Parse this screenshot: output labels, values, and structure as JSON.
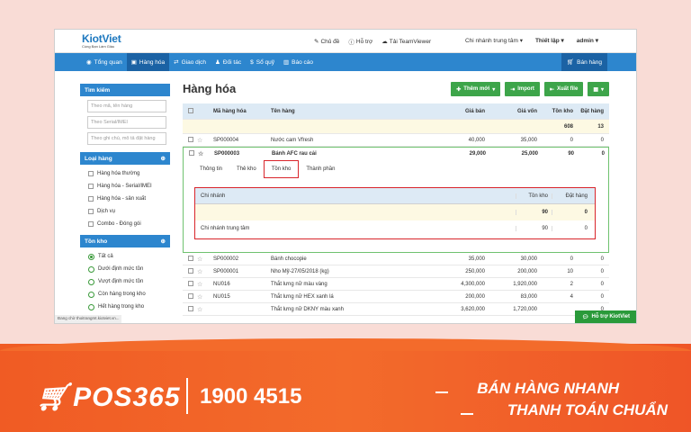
{
  "app": {
    "logo": "KiotViet",
    "logo_sub": "Cùng Bạn Làm Giàu"
  },
  "toplinks": [
    "Chủ đề",
    "Hỗ trợ",
    "Tải TeamViewer"
  ],
  "branch": "Chi nhánh trung tâm",
  "settings": "Thiết lập",
  "user": "admin",
  "nav": [
    "Tổng quan",
    "Hàng hóa",
    "Giao dịch",
    "Đối tác",
    "Sổ quỹ",
    "Báo cáo"
  ],
  "nav_sale": "Bán hàng",
  "sidebar": {
    "search_title": "Tìm kiếm",
    "search_placeholders": [
      "Theo mã, tên hàng",
      "Theo Serial/IMEI",
      "Theo ghi chú, mô tả đặt hàng"
    ],
    "type_title": "Loại hàng",
    "types": [
      "Hàng hóa thường",
      "Hàng hóa - Serial/IMEI",
      "Hàng hóa - sản xuất",
      "Dịch vụ",
      "Combo - Đóng gói"
    ],
    "stock_title": "Tồn kho",
    "stock_opts": [
      "Tất cả",
      "Dưới định mức tồn",
      "Vượt định mức tồn",
      "Còn hàng trong kho",
      "Hết hàng trong kho"
    ]
  },
  "page_title": "Hàng hóa",
  "buttons": {
    "add": "Thêm mới",
    "import": "Import",
    "export": "Xuất file"
  },
  "table": {
    "headers": [
      "Mã hàng hóa",
      "Tên hàng",
      "Giá bán",
      "Giá vốn",
      "Tồn kho",
      "Đặt hàng"
    ],
    "totals": {
      "stock": "608",
      "order": "13"
    },
    "rows_top": [
      {
        "code": "SP000004",
        "name": "Nước cam Vfresh",
        "price": "40,000",
        "cost": "35,000",
        "stock": "0",
        "order": "0"
      },
      {
        "code": "SP000003",
        "name": "Bánh AFC rau cải",
        "price": "29,000",
        "cost": "25,000",
        "stock": "90",
        "order": "0"
      }
    ],
    "rows_bottom": [
      {
        "code": "SP000002",
        "name": "Bánh chocopie",
        "price": "35,000",
        "cost": "30,000",
        "stock": "0",
        "order": "0"
      },
      {
        "code": "SP000001",
        "name": "Nho Mỹ-27/05/2018 (kg)",
        "price": "250,000",
        "cost": "200,000",
        "stock": "10",
        "order": "0"
      },
      {
        "code": "NU016",
        "name": "Thắt lưng nữ màu vàng",
        "price": "4,300,000",
        "cost": "1,920,000",
        "stock": "2",
        "order": "0"
      },
      {
        "code": "NU015",
        "name": "Thắt lưng nữ HEX xanh lá",
        "price": "200,000",
        "cost": "83,000",
        "stock": "4",
        "order": "0"
      },
      {
        "code": "",
        "name": "Thắt lưng nữ DKNY màu xanh",
        "price": "3,620,000",
        "cost": "1,720,000",
        "stock": "",
        "order": "0"
      }
    ]
  },
  "detail": {
    "tabs": [
      "Thông tin",
      "Thẻ kho",
      "Tồn kho",
      "Thành phần"
    ],
    "headers": [
      "Chi nhánh",
      "Tồn kho",
      "Đặt hàng"
    ],
    "sum": {
      "stock": "90",
      "order": "0"
    },
    "row": {
      "branch": "Chi nhánh trung tâm",
      "stock": "90",
      "order": "0"
    }
  },
  "status": "Đang chờ thoitrangmt.kiotviet.vn...",
  "help": "Hỗ trợ KiotViet",
  "banner": {
    "brand": "POS365",
    "phone": "1900 4515",
    "slogan1": "BÁN HÀNG NHANH",
    "slogan2": "THANH TOÁN CHUẨN"
  }
}
